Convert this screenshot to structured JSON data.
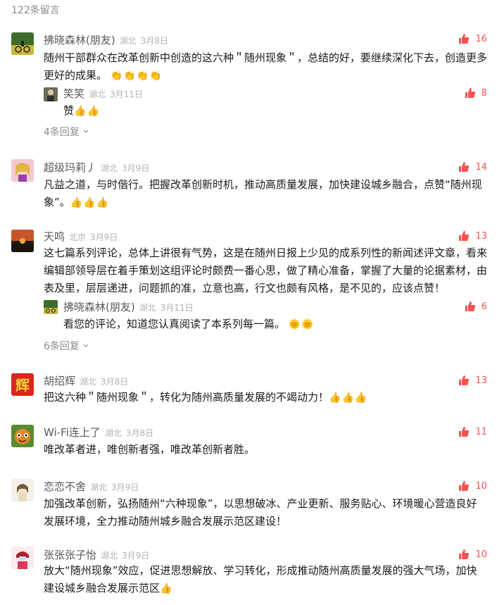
{
  "header": {
    "count_label": "122条留言"
  },
  "colors": {
    "like": "#fa5151",
    "name": "#595959",
    "muted": "#b2b2b2"
  },
  "comments": [
    {
      "name": "拂晓森林(朋友)",
      "location": "湖北",
      "date": "3月8日",
      "likes": "16",
      "text": "随州干部群众在改革创新中创造的这六种＂随州现象＂，总结的好，要继续深化下去，创造更多更好的成果。",
      "emoji": "👏👏👏👏",
      "reply": {
        "name": "笑笑",
        "location": "湖北",
        "date": "3月11日",
        "likes": "8",
        "text": "赞",
        "emoji": "👍👍"
      },
      "more": "4条回复"
    },
    {
      "name": "超级玛莉丿",
      "location": "湖北",
      "date": "3月9日",
      "likes": "14",
      "text": "凡益之道，与时偕行。把握改革创新时机，推动高质量发展，加快建设城乡融合，点赞“随州现象”。",
      "emoji": "👍👍👍"
    },
    {
      "name": "天鸣",
      "location": "北京",
      "date": "3月9日",
      "likes": "13",
      "text": "这七篇系列评论，总体上讲很有气势，这是在随州日报上少见的成系列性的新闻述评文章，看来编辑部领导层在着手策划这组评论时颇费一番心思，做了精心准备，掌握了大量的论据素材，由表及里，层层递进，问题抓的准，立意也高，行文也颇有风格，是不见的，应该点赞！",
      "reply": {
        "name": "拂晓森林(朋友)",
        "location": "湖北",
        "date": "3月11日",
        "likes": "6",
        "text": "看您的评论，知道您认真阅读了本系列每一篇。",
        "emoji": "🌞🌞"
      },
      "more": "6条回复"
    },
    {
      "name": "胡绍辉",
      "location": "湖北",
      "date": "3月8日",
      "likes": "13",
      "text": "把这六种＂随州现象＂，转化为随州高质量发展的不竭动力！",
      "emoji": "👍👍👍"
    },
    {
      "name": "Wi-Fi连上了",
      "location": "湖北",
      "date": "3月8日",
      "likes": "11",
      "text": "唯改革者进，唯创新者强，唯改革创新者胜。"
    },
    {
      "name": "恋恋不舍",
      "location": "湖北",
      "date": "3月9日",
      "likes": "10",
      "text": "加强改革创新，弘扬随州“六种现象”，以思想破冰、产业更新、服务贴心、环境暖心营造良好发展环境，全力推动随州城乡融合发展示范区建设！"
    },
    {
      "name": "张张张子怡",
      "location": "湖北",
      "date": "3月9日",
      "likes": "10",
      "text": "放大“随州现象”效应，促进思想解放、学习转化，形成推动随州高质量发展的强大气场，加快建设城乡融合发展示范区",
      "emoji": "👍"
    }
  ]
}
